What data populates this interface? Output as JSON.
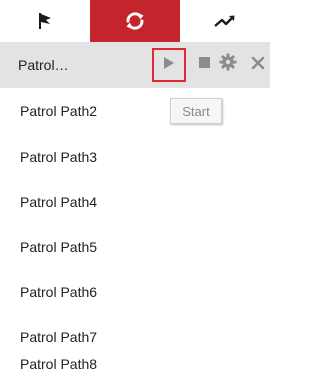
{
  "tabs": [
    {
      "name": "preset",
      "icon": "flag-icon"
    },
    {
      "name": "patrol",
      "icon": "sync-icon",
      "active": true,
      "active_color": "#c4242c"
    },
    {
      "name": "pattern",
      "icon": "trend-icon"
    }
  ],
  "selected_item": {
    "label": "Patrol…",
    "actions": [
      {
        "name": "start",
        "icon": "play-icon",
        "highlight_color": "#e02a3a"
      },
      {
        "name": "stop",
        "icon": "stop-icon"
      },
      {
        "name": "settings",
        "icon": "gear-icon"
      },
      {
        "name": "close",
        "icon": "close-icon"
      }
    ]
  },
  "tooltip": {
    "text": "Start"
  },
  "items": [
    {
      "label": "Patrol Path2"
    },
    {
      "label": "Patrol Path3"
    },
    {
      "label": "Patrol Path4"
    },
    {
      "label": "Patrol Path5"
    },
    {
      "label": "Patrol Path6"
    },
    {
      "label": "Patrol Path7"
    },
    {
      "label": "Patrol Path8"
    }
  ]
}
